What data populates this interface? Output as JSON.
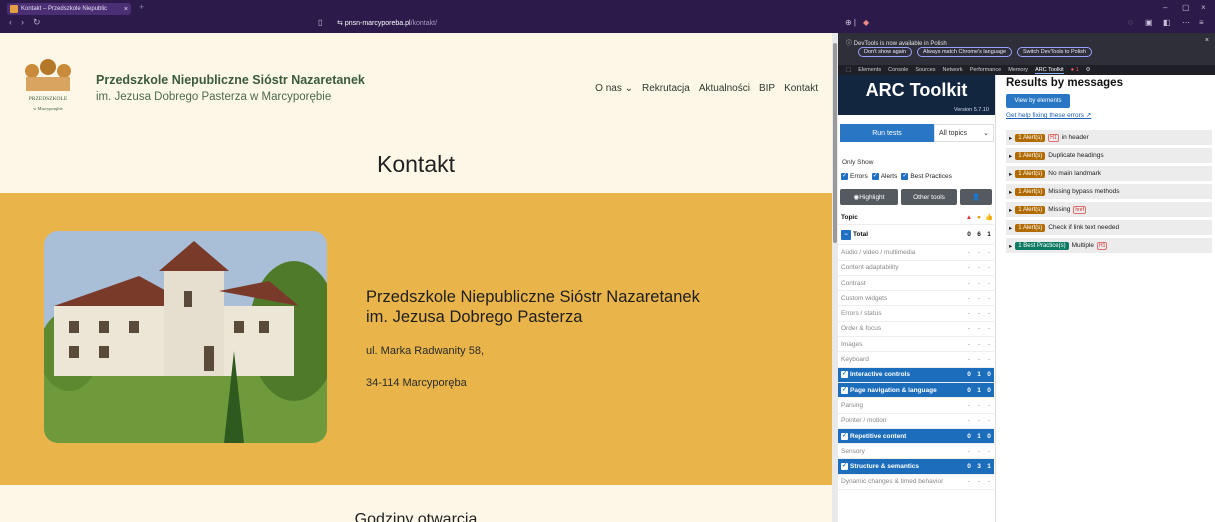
{
  "browser": {
    "tab_title": "Kontakt – Przedszkole Niepublic",
    "url_domain": "pnsn-marcyporeba.pl",
    "url_path": "/kontakt/"
  },
  "site": {
    "brand_line1": "Przedszkole Niepubliczne Sióstr Nazaretanek",
    "brand_line2": "im. Jezusa Dobrego Pasterza w Marcyporębie",
    "logo_text": [
      "PRZEDSZKOLE",
      "w Marcyporębie"
    ],
    "nav": [
      "O nas ⌄",
      "Rekrutacja",
      "Aktualności",
      "BIP",
      "Kontakt"
    ],
    "title": "Kontakt",
    "place_title_1": "Przedszkole Niepubliczne Sióstr Nazaretanek",
    "place_title_2": "im. Jezusa Dobrego Pasterza",
    "address_1": "ul. Marka Radwanity 58,",
    "address_2": "34-114 Marcyporęba",
    "section_2": "Godziny otwarcia"
  },
  "devtools": {
    "notice": "DevTools is now available in Polish",
    "btn_dont": "Don't show again",
    "btn_match": "Always match Chrome's language",
    "btn_switch": "Switch DevTools to Polish",
    "tabs": [
      "Elements",
      "Console",
      "Sources",
      "Network",
      "Performance",
      "Memory",
      "ARC Toolkit"
    ],
    "errors_count": "1"
  },
  "arc": {
    "title": "ARC Toolkit",
    "version": "Version 5.7.10",
    "run_tests": "Run tests",
    "all_topics": "All topics",
    "only_show": "Only Show",
    "filters": [
      "Errors",
      "Alerts",
      "Best Practices"
    ],
    "highlight": "Highlight",
    "other_tools": "Other tools",
    "topic_header": "Topic",
    "total_label": "Total",
    "total_counts": [
      "0",
      "6",
      "1"
    ],
    "rows": [
      {
        "name": "Audio / video / multimedia",
        "counts": [
          "-",
          "-",
          "-"
        ],
        "active": false
      },
      {
        "name": "Content adaptability",
        "counts": [
          "-",
          "-",
          "-"
        ],
        "active": false
      },
      {
        "name": "Contrast",
        "counts": [
          "-",
          "-",
          "-"
        ],
        "active": false
      },
      {
        "name": "Custom widgets",
        "counts": [
          "-",
          "-",
          "-"
        ],
        "active": false
      },
      {
        "name": "Errors / status",
        "counts": [
          "-",
          "-",
          "-"
        ],
        "active": false
      },
      {
        "name": "Order & focus",
        "counts": [
          "-",
          "-",
          "-"
        ],
        "active": false
      },
      {
        "name": "Images",
        "counts": [
          "-",
          "-",
          "-"
        ],
        "active": false
      },
      {
        "name": "Keyboard",
        "counts": [
          "-",
          "-",
          "-"
        ],
        "active": false
      },
      {
        "name": "Interactive controls",
        "counts": [
          "0",
          "1",
          "0"
        ],
        "active": true
      },
      {
        "name": "Page navigation & language",
        "counts": [
          "0",
          "1",
          "0"
        ],
        "active": true
      },
      {
        "name": "Parsing",
        "counts": [
          "-",
          "-",
          "-"
        ],
        "active": false
      },
      {
        "name": "Pointer / motion",
        "counts": [
          "-",
          "-",
          "-"
        ],
        "active": false
      },
      {
        "name": "Repetitive content",
        "counts": [
          "0",
          "1",
          "0"
        ],
        "active": true
      },
      {
        "name": "Sensory",
        "counts": [
          "-",
          "-",
          "-"
        ],
        "active": false
      },
      {
        "name": "Structure & semantics",
        "counts": [
          "0",
          "3",
          "1"
        ],
        "active": true
      },
      {
        "name": "Dynamic changes & timed behavior",
        "counts": [
          "-",
          "-",
          "-"
        ],
        "active": false
      }
    ],
    "results_title": "Results by messages",
    "view_by": "View by elements",
    "help_link": "Get help fixing these errors",
    "results": [
      {
        "badge": "1 Alert(s)",
        "type": "alert",
        "tag": "H1",
        "text": "in header"
      },
      {
        "badge": "1 Alert(s)",
        "type": "alert",
        "tag": "",
        "text": "Duplicate headings"
      },
      {
        "badge": "1 Alert(s)",
        "type": "alert",
        "tag": "",
        "text": "No main landmark"
      },
      {
        "badge": "1 Alert(s)",
        "type": "alert",
        "tag": "",
        "text": "Missing bypass methods"
      },
      {
        "badge": "1 Alert(s)",
        "type": "alert",
        "tag": "href",
        "text": "Missing"
      },
      {
        "badge": "1 Alert(s)",
        "type": "alert",
        "tag": "",
        "text": "Check if link text needed"
      },
      {
        "badge": "1 Best Practice(s)",
        "type": "bp",
        "tag": "H1",
        "text": "Multiple"
      }
    ],
    "colors": {
      "alert": "#b06a00",
      "bp": "#0e7a63",
      "arc_blue": "#2876c4"
    }
  }
}
